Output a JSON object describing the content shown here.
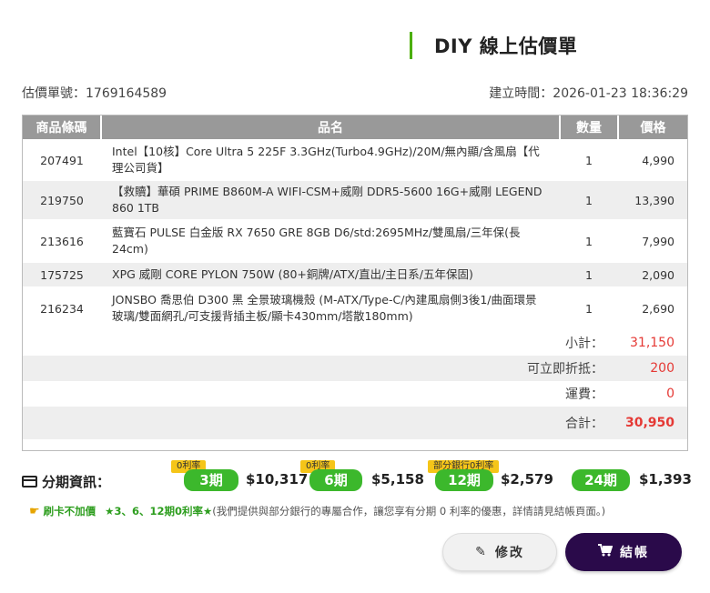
{
  "page": {
    "title": "DIY 線上估價單",
    "estimate_no": "估價單號：1769164589",
    "created_time": "建立時間：2026-01-23 18:36:29"
  },
  "table": {
    "headers": {
      "code": "商品條碼",
      "name": "品名",
      "qty": "數量",
      "price": "價格"
    },
    "rows": [
      {
        "code": "207491",
        "name": "Intel【10核】Core Ultra 5 225F 3.3GHz(Turbo4.9GHz)/20M/無內顯/含風扇【代理公司貨】",
        "qty": "1",
        "price": "4,990"
      },
      {
        "code": "219750",
        "name": "【救贖】華碩 PRIME B860M-A WIFI-CSM+威剛 DDR5-5600 16G+威剛 LEGEND 860 1TB",
        "qty": "1",
        "price": "13,390"
      },
      {
        "code": "213616",
        "name": "藍寶石 PULSE 白金版 RX 7650 GRE 8GB D6/std:2695MHz/雙風扇/三年保(長24cm)",
        "qty": "1",
        "price": "7,990"
      },
      {
        "code": "175725",
        "name": "XPG 威剛 CORE PYLON 750W (80+銅牌/ATX/直出/主日系/五年保固)",
        "qty": "1",
        "price": "2,090"
      },
      {
        "code": "216234",
        "name": "JONSBO 喬思伯 D300 黑 全景玻璃機殼 (M-ATX/Type-C/內建風扇側3後1/曲面環景玻璃/雙面網孔/可支援背插主板/顯卡430mm/塔散180mm)",
        "qty": "1",
        "price": "2,690"
      }
    ]
  },
  "summary": {
    "subtotal_label": "小計：",
    "subtotal": "31,150",
    "discount_label": "可立即折抵：",
    "discount": "200",
    "shipping_label": "運費：",
    "shipping": "0",
    "total_label": "合計：",
    "total": "30,950"
  },
  "installment": {
    "title": "分期資訊：",
    "plans": [
      {
        "tag": "0利率",
        "period": "3期",
        "amount": "$10,317"
      },
      {
        "tag": "0利率",
        "period": "6期",
        "amount": "$5,158"
      },
      {
        "tag": "部分銀行0利率",
        "period": "12期",
        "amount": "$2,579"
      },
      {
        "tag": "",
        "period": "24期",
        "amount": "$1,393"
      }
    ]
  },
  "promo": {
    "bold": "刷卡不加價",
    "highlight": "★3、6、12期0利率★",
    "text": "(我們提供與部分銀行的專屬合作，讓您享有分期 0 利率的優惠，詳情請見結帳頁面。)"
  },
  "buttons": {
    "edit": "修改",
    "checkout": "結帳"
  },
  "colors": {
    "accent_green": "#3cb82c",
    "price_red": "#e53935",
    "checkout_bg": "#2a0a4a",
    "tag_yellow": "#f5c518"
  }
}
